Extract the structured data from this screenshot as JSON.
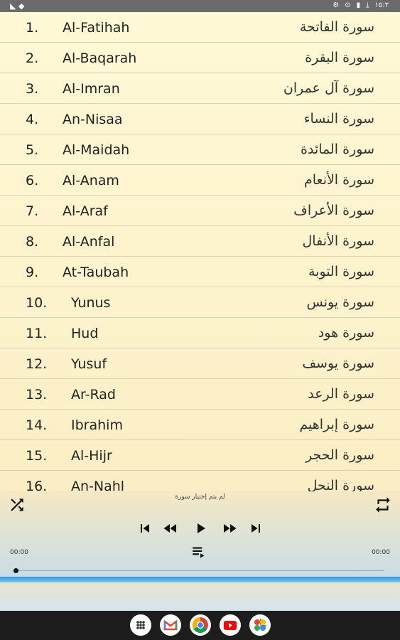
{
  "status_bar": {
    "right_text": "١٥:٣"
  },
  "surahs": [
    {
      "num": "1.",
      "en": "Al-Fatihah",
      "ar": "سورة الفاتحة"
    },
    {
      "num": "2.",
      "en": "Al-Baqarah",
      "ar": "سورة البقرة"
    },
    {
      "num": "3.",
      "en": "Al-Imran",
      "ar": "سورة آل عمران"
    },
    {
      "num": "4.",
      "en": "An-Nisaa",
      "ar": "سورة النساء"
    },
    {
      "num": "5.",
      "en": "Al-Maidah",
      "ar": "سورة المائدة"
    },
    {
      "num": "6.",
      "en": "Al-Anam",
      "ar": "سورة الأنعام"
    },
    {
      "num": "7.",
      "en": "Al-Araf",
      "ar": "سورة الأعراف"
    },
    {
      "num": "8.",
      "en": "Al-Anfal",
      "ar": "سورة الأنفال"
    },
    {
      "num": "9.",
      "en": "At-Taubah",
      "ar": "سورة التوبة"
    },
    {
      "num": "10.",
      "en": "Yunus",
      "ar": "سورة يونس"
    },
    {
      "num": "11.",
      "en": "Hud",
      "ar": "سورة هود"
    },
    {
      "num": "12.",
      "en": "Yusuf",
      "ar": "سورة يوسف"
    },
    {
      "num": "13.",
      "en": "Ar-Rad",
      "ar": "سورة الرعد"
    },
    {
      "num": "14.",
      "en": "Ibrahim",
      "ar": "سورة إبراهيم"
    },
    {
      "num": "15.",
      "en": "Al-Hijr",
      "ar": "سورة الحجر"
    },
    {
      "num": "16.",
      "en": "An-Nahl",
      "ar": "سورة النحل"
    }
  ],
  "player": {
    "now_playing": "لم يتم إختيار سورة",
    "time_elapsed": "00:00",
    "time_total": "00:00",
    "progress": 0
  },
  "icons": {
    "shuffle": "shuffle-icon",
    "repeat": "repeat-icon",
    "skip_previous": "skip-previous-icon",
    "rewind": "rewind-icon",
    "play": "play-icon",
    "fast_forward": "fast-forward-icon",
    "skip_next": "skip-next-icon",
    "playlist": "playlist-icon"
  },
  "nav_apps": [
    "app-drawer-icon",
    "gmail-icon",
    "chrome-icon",
    "youtube-icon",
    "photos-icon"
  ],
  "colors": {
    "accent_blue": "#2a98e8",
    "status_bar": "#6b6b6b",
    "nav_bar": "#1d1d1d"
  }
}
